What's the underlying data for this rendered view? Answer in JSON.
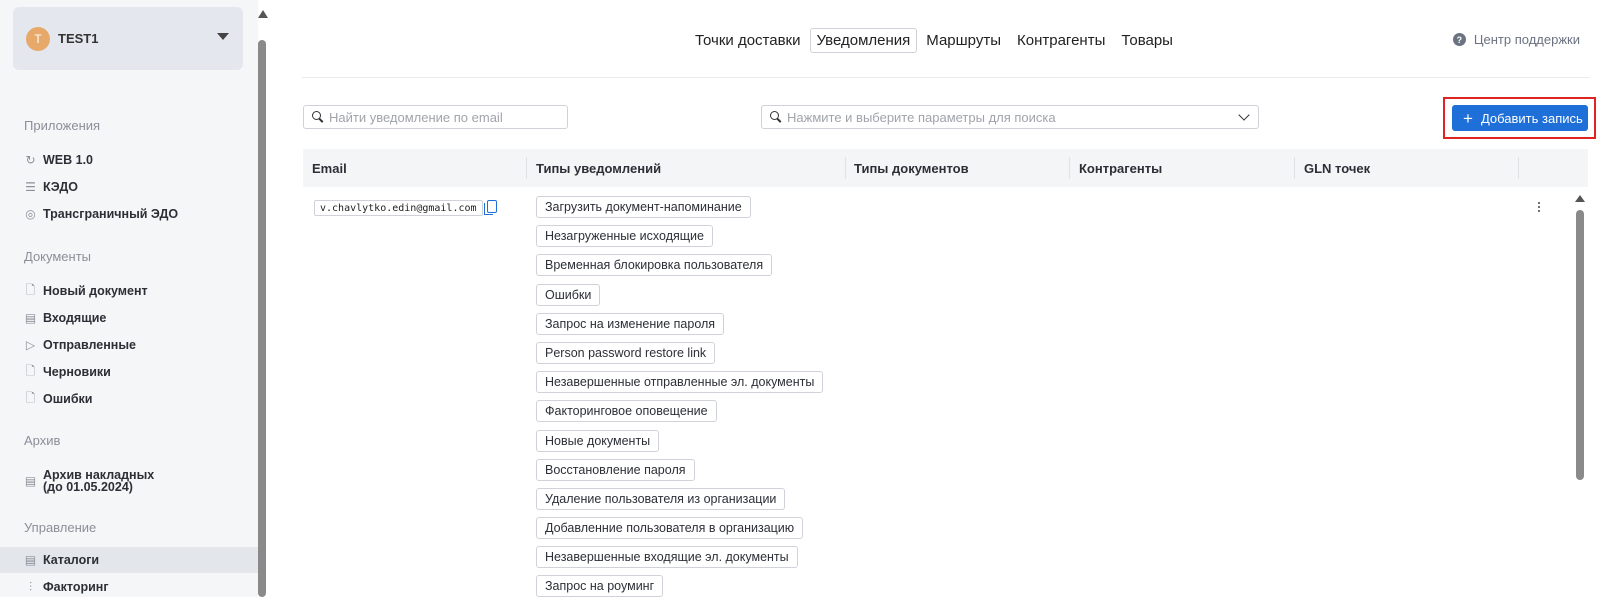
{
  "org": {
    "avatar_letter": "T",
    "name": "TEST1"
  },
  "sidebar": {
    "sections": [
      {
        "title": "Приложения",
        "items": [
          {
            "label": "WEB 1.0",
            "icon": "refresh-icon"
          },
          {
            "label": "КЭДО",
            "icon": "document-list-icon"
          },
          {
            "label": "Трансграничный ЭДО",
            "icon": "globe-icon"
          }
        ]
      },
      {
        "title": "Документы",
        "items": [
          {
            "label": "Новый документ",
            "icon": "new-document-icon"
          },
          {
            "label": "Входящие",
            "icon": "inbox-icon"
          },
          {
            "label": "Отправленные",
            "icon": "send-icon"
          },
          {
            "label": "Черновики",
            "icon": "draft-icon"
          },
          {
            "label": "Ошибки",
            "icon": "error-document-icon"
          }
        ]
      },
      {
        "title": "Архив",
        "items": [
          {
            "label_line1": "Архив накладных",
            "label_line2": "(до 01.05.2024)",
            "icon": "archive-icon"
          }
        ]
      },
      {
        "title": "Управление",
        "items": [
          {
            "label": "Каталоги",
            "icon": "catalog-icon",
            "active": true
          },
          {
            "label": "Факторинг",
            "icon": "chart-icon"
          }
        ]
      }
    ]
  },
  "tabs": [
    {
      "label": "Точки доставки",
      "active": false
    },
    {
      "label": "Уведомления",
      "active": true
    },
    {
      "label": "Маршруты",
      "active": false
    },
    {
      "label": "Контрагенты",
      "active": false
    },
    {
      "label": "Товары",
      "active": false
    }
  ],
  "support_label": "Центр поддержки",
  "email_search_placeholder": "Найти уведомление по email",
  "param_search_placeholder": "Нажмите и выберите параметры для поиска",
  "add_button_label": "Добавить запись",
  "table": {
    "columns": [
      "Email",
      "Типы уведомлений",
      "Типы документов",
      "Контрагенты",
      "GLN точек"
    ],
    "rows": [
      {
        "email": "v.chavlytko.edin@gmail.com",
        "notification_types": [
          "Загрузить документ-напоминание",
          "Незагруженные исходящие",
          "Временная блокировка пользователя",
          "Ошибки",
          "Запрос на изменение пароля",
          "Person password restore link",
          "Незавершенные отправленные эл. документы",
          "Факторинговое оповещение",
          "Новые документы",
          "Восстановление пароля",
          "Удаление пользователя из организации",
          "Добавленние пользователя в организацию",
          "Незавершенные входящие эл. документы",
          "Запрос на роуминг"
        ]
      }
    ]
  },
  "colors": {
    "accent": "#1f6fd8",
    "highlight_border": "#e02424",
    "avatar": "#e6a96a"
  }
}
